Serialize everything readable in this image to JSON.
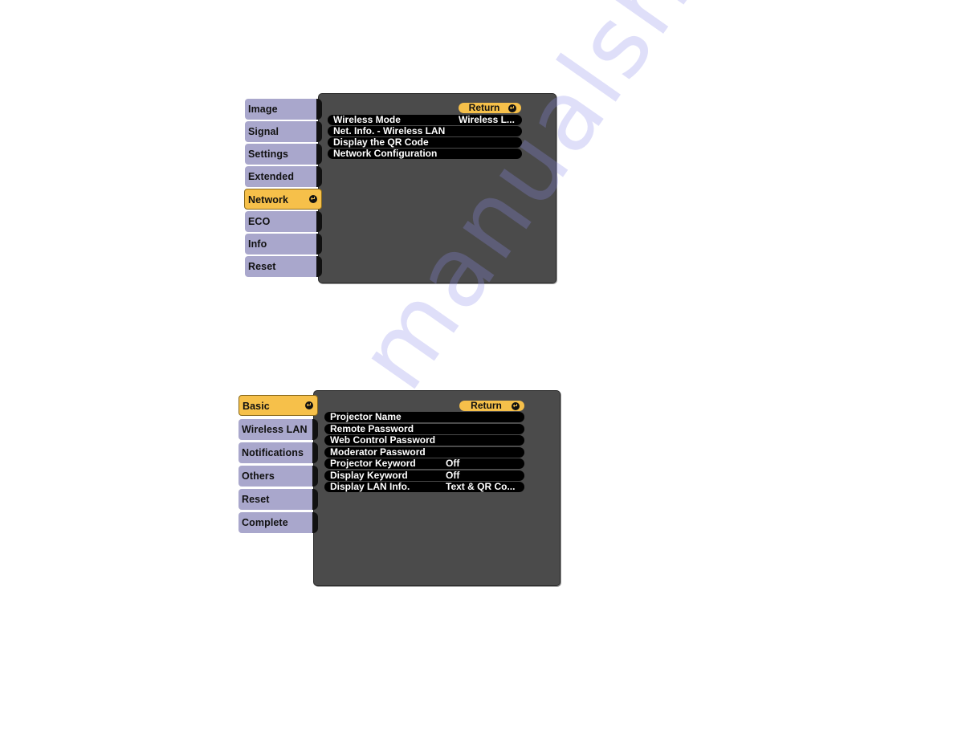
{
  "menu_network": {
    "tabs": [
      {
        "label": "Image",
        "active": false
      },
      {
        "label": "Signal",
        "active": false
      },
      {
        "label": "Settings",
        "active": false
      },
      {
        "label": "Extended",
        "active": false
      },
      {
        "label": "Network",
        "active": true
      },
      {
        "label": "ECO",
        "active": false
      },
      {
        "label": "Info",
        "active": false
      },
      {
        "label": "Reset",
        "active": false
      }
    ],
    "return_label": "Return",
    "items": [
      {
        "label": "Wireless Mode",
        "value": "Wireless L..."
      },
      {
        "label": "Net. Info. - Wireless LAN",
        "value": ""
      },
      {
        "label": "Display the QR Code",
        "value": ""
      },
      {
        "label": "Network Configuration",
        "value": ""
      }
    ]
  },
  "menu_network_config": {
    "tabs": [
      {
        "label": "Basic",
        "active": true
      },
      {
        "label": "Wireless LAN",
        "active": false
      },
      {
        "label": "Notifications",
        "active": false
      },
      {
        "label": "Others",
        "active": false
      },
      {
        "label": "Reset",
        "active": false
      },
      {
        "label": "Complete",
        "active": false
      }
    ],
    "return_label": "Return",
    "items": [
      {
        "label": "Projector Name",
        "value": ""
      },
      {
        "label": "Remote Password",
        "value": ""
      },
      {
        "label": "Web Control Password",
        "value": ""
      },
      {
        "label": "Moderator Password",
        "value": ""
      },
      {
        "label": "Projector Keyword",
        "value": "Off"
      },
      {
        "label": "Display Keyword",
        "value": "Off"
      },
      {
        "label": "Display LAN Info.",
        "value": "Text & QR Co..."
      }
    ]
  },
  "icons": {
    "enter": "↵"
  },
  "watermark": "manualshive.com",
  "colors": {
    "active_tab": "#f6c04a",
    "inactive_tab": "#a9a7cc",
    "panel": "#4b4b4b",
    "row": "#000000"
  }
}
